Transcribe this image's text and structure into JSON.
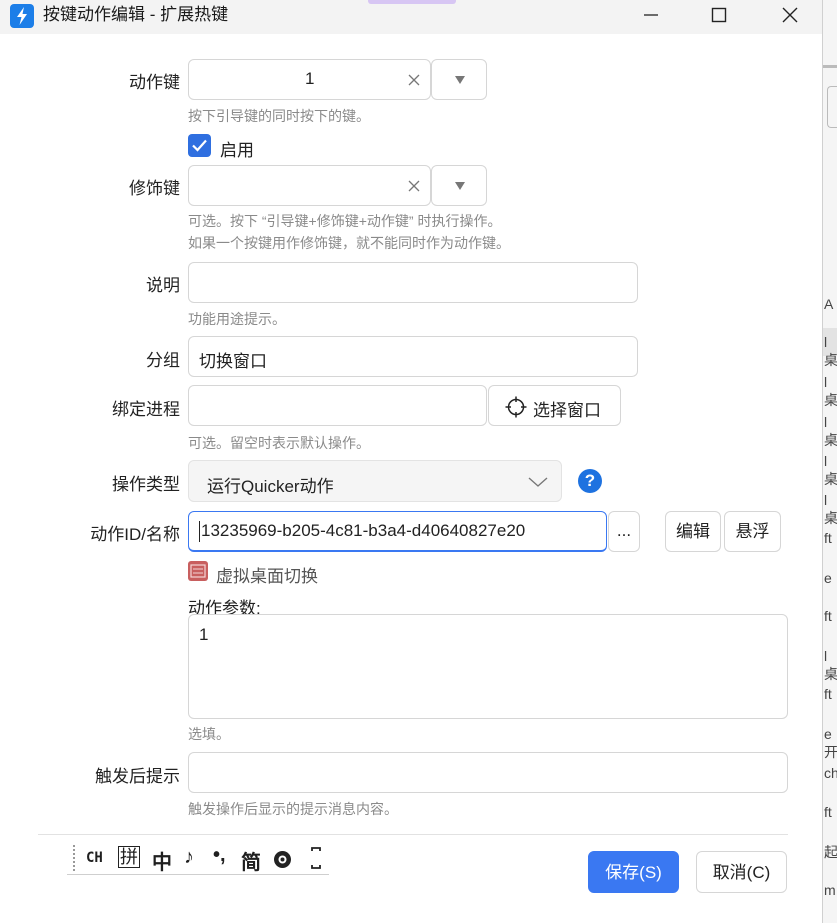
{
  "window": {
    "title": "按键动作编辑 - 扩展热键"
  },
  "fields": {
    "action_key": {
      "label": "动作键",
      "value": "1",
      "hint": "按下引导键的同时按下的键。"
    },
    "enable": {
      "label": "启用",
      "checked": true
    },
    "modifier_key": {
      "label": "修饰键",
      "value": "",
      "hint_line1": "可选。按下 “引导键+修饰键+动作键” 时执行操作。",
      "hint_line2": "如果一个按键用作修饰键，就不能同时作为动作键。"
    },
    "description": {
      "label": "说明",
      "value": "",
      "hint": "功能用途提示。"
    },
    "group": {
      "label": "分组",
      "value": "切换窗口"
    },
    "bind_process": {
      "label": "绑定进程",
      "value": "",
      "select_window_label": "选择窗口",
      "hint": "可选。留空时表示默认操作。"
    },
    "operation_type": {
      "label": "操作类型",
      "value": "运行Quicker动作"
    },
    "action_id": {
      "label": "动作ID/名称",
      "value": "13235969-b205-4c81-b3a4-d40640827e20",
      "browse_label": "...",
      "edit_label": "编辑",
      "float_label": "悬浮",
      "action_name": "虚拟桌面切换"
    },
    "params": {
      "label": "动作参数:",
      "value": "1",
      "hint": "选填。"
    },
    "after_tip": {
      "label": "触发后提示",
      "value": "",
      "hint": "触发操作后显示的提示消息内容。"
    }
  },
  "ime_bar": {
    "lang": "CH",
    "mode1": "拼",
    "mode2": "中",
    "mode3": "♪",
    "mode4": "•,",
    "mode5": "简"
  },
  "footer": {
    "save_label": "保存(S)",
    "cancel_label": "取消(C)"
  },
  "colors": {
    "accent": "#3a78f2",
    "help": "#1e72e0",
    "checkbox": "#2f6fe0"
  },
  "background_strip": [
    "A",
    "l桌",
    "l桌",
    "l桌",
    "l桌",
    "l桌",
    "ft",
    "e",
    "ft",
    "l桌",
    "ft",
    "e开",
    "ch",
    "ft",
    "起",
    "m"
  ]
}
